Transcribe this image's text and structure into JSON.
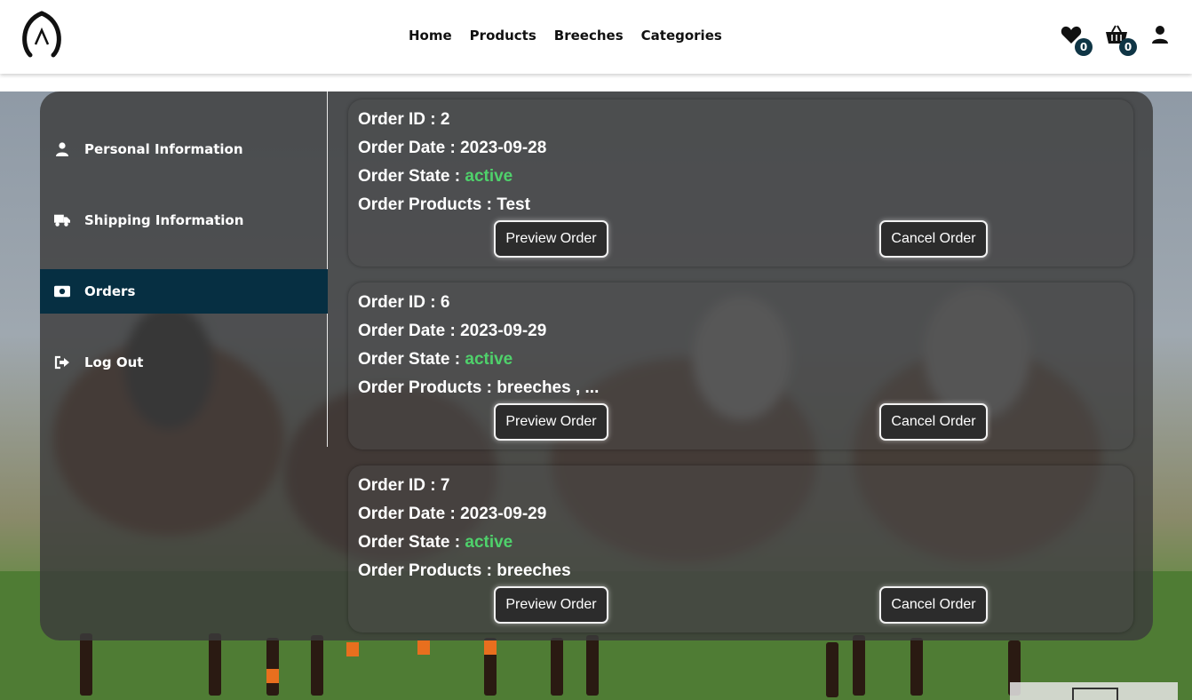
{
  "header": {
    "logo_icon": "horseshoe-logo-icon",
    "nav": [
      {
        "label": "Home"
      },
      {
        "label": "Products"
      },
      {
        "label": "Breeches"
      },
      {
        "label": "Categories"
      }
    ],
    "wishlist_count": "0",
    "cart_count": "0",
    "icons": {
      "wishlist": "heart-icon",
      "cart": "basket-icon",
      "account": "user-icon"
    },
    "badge_color": "#0f3545"
  },
  "sidebar": {
    "items": [
      {
        "label": "Personal Information",
        "icon": "user-icon",
        "active": false
      },
      {
        "label": "Shipping Information",
        "icon": "truck-icon",
        "active": false
      },
      {
        "label": "Orders",
        "icon": "money-icon",
        "active": true
      },
      {
        "label": "Log Out",
        "icon": "logout-icon",
        "active": false
      }
    ],
    "active_color": "#062f42"
  },
  "orders": [
    {
      "id_label": "Order ID : 2",
      "date_label": "Order Date : 2023-09-28",
      "state_prefix": "Order State : ",
      "state": "active",
      "products_label": "Order Products : Test",
      "preview_label": "Preview Order",
      "cancel_label": "Cancel Order"
    },
    {
      "id_label": "Order ID : 6",
      "date_label": "Order Date : 2023-09-29",
      "state_prefix": "Order State : ",
      "state": "active",
      "products_label": "Order Products : breeches , ...",
      "preview_label": "Preview Order",
      "cancel_label": "Cancel Order"
    },
    {
      "id_label": "Order ID : 7",
      "date_label": "Order Date : 2023-09-29",
      "state_prefix": "Order State : ",
      "state": "active",
      "products_label": "Order Products : breeches",
      "preview_label": "Preview Order",
      "cancel_label": "Cancel Order"
    }
  ],
  "colors": {
    "state_active": "#4fd16b",
    "panel": "rgba(60,60,60,0.82)"
  }
}
